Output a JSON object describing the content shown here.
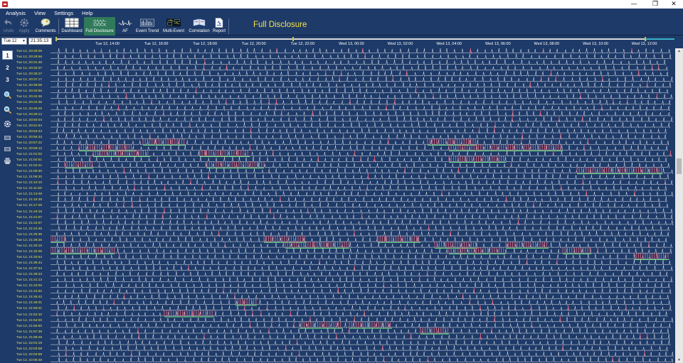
{
  "window": {
    "min_label": "—",
    "max_label": "❐",
    "close_label": "✕"
  },
  "menu": [
    "Analysis",
    "View",
    "Settings",
    "Help"
  ],
  "toolbar": {
    "undo": "Undo",
    "apply": "Apply",
    "comments": "Comments",
    "dashboard": "Dashboard",
    "full_disclosure": "Full Disclosure",
    "af": "AF",
    "event_trend": "Event Trend",
    "multi_event": "Multi-Event",
    "correlation": "Correlation",
    "report": "Report"
  },
  "page_title": "Full Disclosure",
  "date_select": "Tue 12",
  "time_field": "21:35:13",
  "timeline_labels": [
    "Tue 12, 14:00",
    "Tue 12, 16:00",
    "Tue 12, 18:00",
    "Tue 12, 20:00",
    "Tue 12, 22:00",
    "Wed 13, 00:00",
    "Wed 13, 02:00",
    "Wed 13, 04:00",
    "Wed 13, 06:00",
    "Wed 13, 08:00",
    "Wed 13, 10:00",
    "Wed 13, 12:00"
  ],
  "channels": [
    "1",
    "2",
    "3"
  ],
  "selected_channel": "1",
  "strip_times": [
    "Tue 12, 20:28:09",
    "Tue 12, 20:29:56",
    "Tue 12, 20:31:48",
    "Tue 12, 20:33:37",
    "Tue 12, 20:35:27",
    "Tue 12, 20:37:17",
    "Tue 12, 20:39:06",
    "Tue 12, 20:40:56",
    "Tue 12, 20:42:45",
    "Tue 12, 20:44:35",
    "Tue 12, 20:46:25",
    "Tue 12, 20:48:14",
    "Tue 12, 20:50:04",
    "Tue 12, 20:51:54",
    "Tue 12, 20:53:43",
    "Tue 12, 20:55:33",
    "Tue 12, 20:57:22",
    "Tue 12, 20:59:12",
    "Tue 12, 21:01:02",
    "Tue 12, 21:02:51",
    "Tue 12, 21:04:41",
    "Tue 12, 21:06:30",
    "Tue 12, 21:08:20",
    "Tue 12, 21:10:10",
    "Tue 12, 21:11:59",
    "Tue 12, 21:13:49",
    "Tue 12, 21:15:38",
    "Tue 12, 21:17:28",
    "Tue 12, 21:19:18",
    "Tue 12, 21:21:07",
    "Tue 12, 21:22:57",
    "Tue 12, 21:24:46",
    "Tue 12, 21:26:36",
    "Tue 12, 21:28:26",
    "Tue 12, 21:30:15",
    "Tue 12, 21:32:05",
    "Tue 12, 21:33:54",
    "Tue 12, 21:35:44",
    "Tue 12, 21:37:34",
    "Tue 12, 21:39:23",
    "Tue 12, 21:41:13",
    "Tue 12, 21:43:02",
    "Tue 12, 21:44:52",
    "Tue 12, 21:46:42",
    "Tue 12, 21:48:31",
    "Tue 12, 21:50:21",
    "Tue 12, 21:52:10",
    "Tue 12, 21:54:00",
    "Tue 12, 21:55:50",
    "Tue 12, 21:57:39",
    "Tue 12, 21:59:29",
    "Tue 12, 22:01:19",
    "Tue 12, 22:03:08",
    "Tue 12, 22:04:58",
    "Tue 12, 22:06:48"
  ],
  "icons": {
    "undo": "undo-arrow-icon",
    "apply": "gear-icon",
    "comments": "comment-bubble-icon",
    "dashboard": "dashboard-grid-icon",
    "full_disclosure": "ecg-strips-icon",
    "af": "af-wave-icon",
    "event_trend": "event-trend-icon",
    "multi_event": "multi-event-icon",
    "correlation": "correlation-book-icon",
    "report": "report-document-icon"
  },
  "colors": {
    "background": "#1e3a68",
    "timestamp": "#e6e24a",
    "title": "#f5e34a",
    "trace": "#ffffff",
    "ectopic": "#e0607a",
    "annotation": "#6fe07a",
    "active_tool": "#2f7a5b"
  }
}
